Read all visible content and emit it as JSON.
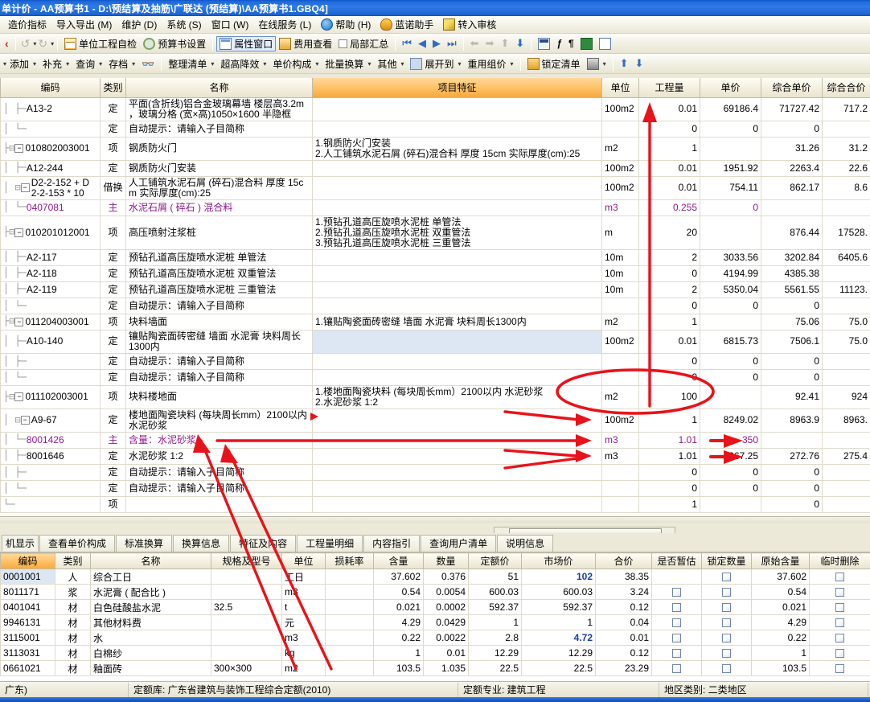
{
  "window": {
    "title": "单计价  -  AA预算书1  -  D:\\预结算及抽筋\\广联达 (预结算)\\AA预算书1.GBQ4]"
  },
  "menubar": {
    "items": [
      {
        "label": "造价指标",
        "icon": ""
      },
      {
        "label": "导入导出 (M)",
        "icon": ""
      },
      {
        "label": "维护 (D)",
        "icon": ""
      },
      {
        "label": "系统 (S)",
        "icon": ""
      },
      {
        "label": "窗口 (W)",
        "icon": ""
      },
      {
        "label": "在线服务 (L)",
        "icon": ""
      },
      {
        "label": "帮助 (H)",
        "icon": "help-icon"
      },
      {
        "label": "蓝诺助手",
        "icon": "hat-icon"
      },
      {
        "label": "转入审核",
        "icon": "pencil-icon"
      }
    ]
  },
  "toolbar1": {
    "back_icon": "back-chevron-icon",
    "undo_label": "↺",
    "redo_label": "↻",
    "items": [
      {
        "label": "单位工程自检",
        "icon": "grid-check-icon"
      },
      {
        "label": "预算书设置",
        "icon": "gear-icon"
      },
      {
        "label": "属性窗口",
        "icon": "property-window-icon",
        "boxed": true
      },
      {
        "label": "费用查看",
        "icon": "fee-icon"
      },
      {
        "label": "局部汇总",
        "icon": "checkbox-icon"
      }
    ],
    "nav": [
      "⏮",
      "◀",
      "▶",
      "⏭"
    ],
    "nav2": [
      "⬅",
      "➡",
      "⬆",
      "⬇"
    ],
    "right_icons": [
      "calculator-icon",
      "function-icon",
      "pilcrow-icon",
      "book-icon",
      "list-icon"
    ]
  },
  "toolbar2": {
    "items": [
      {
        "label": "添加",
        "caret": true
      },
      {
        "label": "补充",
        "caret": true
      },
      {
        "label": "查询",
        "caret": true
      },
      {
        "label": "存档",
        "caret": true
      },
      {
        "label": "",
        "icon": "binoculars-icon"
      },
      {
        "label": "整理清单",
        "caret": true
      },
      {
        "label": "超高降效",
        "caret": true
      },
      {
        "label": "单价构成",
        "caret": true
      },
      {
        "label": "批量换算",
        "caret": true
      },
      {
        "label": "其他",
        "caret": true
      },
      {
        "label": "展开到",
        "caret": true,
        "icon": "expand-to-icon"
      },
      {
        "label": "重用组价",
        "caret": true
      },
      {
        "label": "锁定清单",
        "icon": "lock-icon"
      },
      {
        "label": "",
        "icon": "fill-color-icon",
        "caret": true
      }
    ],
    "up_arrow": "⬆",
    "down_arrow": "⬇"
  },
  "main_grid": {
    "columns": [
      "编码",
      "类别",
      "名称",
      "项目特征",
      "单位",
      "工程量",
      "单价",
      "综合单价",
      "综合合价"
    ],
    "highlight_column": "项目特征",
    "rows": [
      {
        "tree": "│  ├─",
        "code": "A13-2",
        "cat": "定",
        "name": "平面(含折线)铝合金玻璃幕墙 楼层高3.2m\n，玻璃分格 (宽×高)1050×1600 半隐框",
        "feature": "",
        "unit": "100m2",
        "qty": "0.01",
        "price": "69186.4",
        "uprice": "71727.42",
        "total": "717.2"
      },
      {
        "tree": "│  └─",
        "code": "",
        "cat": "定",
        "name": "自动提示：请输入子目简称",
        "ghost": true,
        "feature": "",
        "unit": "",
        "qty": "0",
        "price": "0",
        "uprice": "0",
        "total": ""
      },
      {
        "tree": "├⊟",
        "expander": "−",
        "code": "010802003001",
        "cat": "项",
        "name": "钢质防火门",
        "feature": "1.钢质防火门安装\n2.人工铺筑水泥石屑 (碎石)混合料  厚度 15cm  实际厚度(cm):25",
        "unit": "m2",
        "qty": "1",
        "price": "",
        "uprice": "31.26",
        "total": "31.2"
      },
      {
        "tree": "│  ├─",
        "code": "A12-244",
        "cat": "定",
        "name": "钢质防火门安装",
        "feature": "",
        "unit": "100m2",
        "qty": "0.01",
        "price": "1951.92",
        "uprice": "2263.4",
        "total": "22.6"
      },
      {
        "tree": "│  ⊟",
        "expander": "−",
        "code": "D2-2-152 + D\n2-2-153 * 10",
        "cat": "借换",
        "name": "人工铺筑水泥石屑 (碎石)混合料  厚度 15c\nm  实际厚度(cm):25",
        "feature": "",
        "unit": "100m2",
        "qty": "0.01",
        "price": "754.11",
        "uprice": "862.17",
        "total": "8.6"
      },
      {
        "tree": "│    └─",
        "code": "0407081",
        "cat": "主",
        "name": "水泥石屑 ( 碎石 ) 混合料",
        "zhu": true,
        "feature": "",
        "unit": "m3",
        "qty": "0.255",
        "price": "0",
        "uprice": "",
        "total": ""
      },
      {
        "tree": "├⊟",
        "expander": "−",
        "code": "010201012001",
        "cat": "项",
        "name": "高压喷射注浆桩",
        "feature": "1.预钻孔道高压旋喷水泥桩  单管法\n2.预钻孔道高压旋喷水泥桩  双重管法\n3.预钻孔道高压旋喷水泥桩  三重管法",
        "unit": "m",
        "qty": "20",
        "price": "",
        "uprice": "876.44",
        "total": "17528."
      },
      {
        "tree": "│  ├─",
        "code": "A2-117",
        "cat": "定",
        "name": "预钻孔道高压旋喷水泥桩  单管法",
        "feature": "",
        "unit": "10m",
        "qty": "2",
        "price": "3033.56",
        "uprice": "3202.84",
        "total": "6405.6"
      },
      {
        "tree": "│  ├─",
        "code": "A2-118",
        "cat": "定",
        "name": "预钻孔道高压旋喷水泥桩  双重管法",
        "feature": "",
        "unit": "10m",
        "qty": "0",
        "price": "4194.99",
        "uprice": "4385.38",
        "total": ""
      },
      {
        "tree": "│  ├─",
        "code": "A2-119",
        "cat": "定",
        "name": "预钻孔道高压旋喷水泥桩  三重管法",
        "feature": "",
        "unit": "10m",
        "qty": "2",
        "price": "5350.04",
        "uprice": "5561.55",
        "total": "11123."
      },
      {
        "tree": "│  └─",
        "code": "",
        "cat": "定",
        "name": "自动提示：请输入子目简称",
        "ghost": true,
        "feature": "",
        "unit": "",
        "qty": "0",
        "price": "0",
        "uprice": "0",
        "total": ""
      },
      {
        "tree": "├⊟",
        "expander": "−",
        "code": "011204003001",
        "cat": "项",
        "name": "块料墙面",
        "feature": "1.镶贴陶瓷面砖密缝 墙面 水泥膏 块料周长1300内",
        "unit": "m2",
        "qty": "1",
        "price": "",
        "uprice": "75.06",
        "total": "75.0"
      },
      {
        "tree": "│  ├─",
        "code": "A10-140",
        "cat": "定",
        "name": "镶贴陶瓷面砖密缝  墙面  水泥膏  块料周长\n1300内",
        "feature": "",
        "unit": "100m2",
        "qty": "0.01",
        "price": "6815.73",
        "uprice": "7506.1",
        "total": "75.0",
        "selected": true
      },
      {
        "tree": "│  ├─",
        "code": "",
        "cat": "定",
        "name": "自动提示：请输入子目简称",
        "ghost": true,
        "feature": "",
        "unit": "",
        "qty": "0",
        "price": "0",
        "uprice": "0",
        "total": ""
      },
      {
        "tree": "│  └─",
        "code": "",
        "cat": "定",
        "name": "自动提示：请输入子目简称",
        "ghost": true,
        "feature": "",
        "unit": "",
        "qty": "0",
        "price": "0",
        "uprice": "0",
        "total": ""
      },
      {
        "tree": "├⊟",
        "expander": "−",
        "code": "011102003001",
        "cat": "项",
        "name": "块料楼地面",
        "feature": "1.楼地面陶瓷块料 (每块周长mm）2100以内  水泥砂浆\n2.水泥砂浆 1:2",
        "unit": "m2",
        "qty": "100",
        "price": "",
        "uprice": "92.41",
        "total": "924"
      },
      {
        "tree": "│  ⊟",
        "expander": "−",
        "code": "A9-67",
        "cat": "定",
        "name": "楼地面陶瓷块料 (每块周长mm）2100以内\n水泥砂浆",
        "feature": "",
        "unit": "100m2",
        "qty": "1",
        "price": "8249.02",
        "uprice": "8963.9",
        "total": "8963."
      },
      {
        "tree": "│    └─",
        "code": "8001426",
        "cat": "主",
        "name": "含量：水泥砂浆",
        "zhu": true,
        "feature": "",
        "unit": "m3",
        "qty": "1.01",
        "price": "350",
        "uprice": "",
        "total": ""
      },
      {
        "tree": "│  ├─",
        "code": "8001646",
        "cat": "定",
        "name": "水泥砂浆 1:2",
        "feature": "",
        "unit": "m3",
        "qty": "1.01",
        "price": "267.25",
        "uprice": "272.76",
        "total": "275.4"
      },
      {
        "tree": "│  ├─",
        "code": "",
        "cat": "定",
        "name": "自动提示：请输入子目简称",
        "ghost": true,
        "feature": "",
        "unit": "",
        "qty": "0",
        "price": "0",
        "uprice": "0",
        "total": ""
      },
      {
        "tree": "│  └─",
        "code": "",
        "cat": "定",
        "name": "自动提示：请输入子目简称",
        "ghost": true,
        "feature": "",
        "unit": "",
        "qty": "0",
        "price": "0",
        "uprice": "0",
        "total": ""
      },
      {
        "tree": "└─",
        "code": "",
        "cat": "项",
        "name": "",
        "feature": "",
        "unit": "",
        "qty": "1",
        "price": "",
        "uprice": "0",
        "total": ""
      }
    ]
  },
  "bottom_tabs": {
    "items": [
      {
        "label": "机显示",
        "active": true,
        "partial": true
      },
      {
        "label": "查看单价构成"
      },
      {
        "label": "标准换算"
      },
      {
        "label": "换算信息"
      },
      {
        "label": "特征及内容"
      },
      {
        "label": "工程量明细"
      },
      {
        "label": "内容指引"
      },
      {
        "label": "查询用户清单"
      },
      {
        "label": "说明信息"
      }
    ]
  },
  "bottom_grid": {
    "columns": [
      "编码",
      "类别",
      "名称",
      "规格及型号",
      "单位",
      "损耗率",
      "含量",
      "数量",
      "定额价",
      "市场价",
      "合价",
      "是否暂估",
      "锁定数量",
      "原始含量",
      "临时删除"
    ],
    "highlight_column": "编码",
    "rows": [
      {
        "code": "0001001",
        "cat": "人",
        "name": "综合工日",
        "spec": "",
        "unit": "工日",
        "loss": "",
        "content": "37.602",
        "qty": "0.376",
        "dprice": "51",
        "mprice": "102",
        "mprice_bold": true,
        "total": "38.35",
        "estimate": false,
        "estimate_show": false,
        "lock": true,
        "orig": "37.602",
        "del": true,
        "selected": true
      },
      {
        "code": "8011171",
        "cat": "浆",
        "name": "水泥膏 ( 配合比 )",
        "spec": "",
        "unit": "m3",
        "loss": "",
        "content": "0.54",
        "qty": "0.0054",
        "dprice": "600.03",
        "mprice": "600.03",
        "total": "3.24",
        "estimate": true,
        "estimate_show": true,
        "lock": true,
        "orig": "0.54",
        "del": true
      },
      {
        "code": "0401041",
        "cat": "材",
        "name": "白色硅酸盐水泥",
        "spec": "32.5",
        "unit": "t",
        "loss": "",
        "content": "0.021",
        "qty": "0.0002",
        "dprice": "592.37",
        "mprice": "592.37",
        "total": "0.12",
        "estimate": true,
        "estimate_show": true,
        "lock": true,
        "orig": "0.021",
        "del": true
      },
      {
        "code": "9946131",
        "cat": "材",
        "name": "其他材料费",
        "spec": "",
        "unit": "元",
        "loss": "",
        "content": "4.29",
        "qty": "0.0429",
        "dprice": "1",
        "mprice": "1",
        "total": "0.04",
        "estimate": true,
        "estimate_show": true,
        "lock": true,
        "orig": "4.29",
        "del": true
      },
      {
        "code": "3115001",
        "cat": "材",
        "name": "水",
        "spec": "",
        "unit": "m3",
        "loss": "",
        "content": "0.22",
        "qty": "0.0022",
        "dprice": "2.8",
        "mprice": "4.72",
        "mprice_bold": true,
        "total": "0.01",
        "estimate": true,
        "estimate_show": true,
        "lock": true,
        "orig": "0.22",
        "del": true
      },
      {
        "code": "3113031",
        "cat": "材",
        "name": "白棉纱",
        "spec": "",
        "unit": "kg",
        "loss": "",
        "content": "1",
        "qty": "0.01",
        "dprice": "12.29",
        "mprice": "12.29",
        "total": "0.12",
        "estimate": true,
        "estimate_show": true,
        "lock": true,
        "orig": "1",
        "del": true
      },
      {
        "code": "0661021",
        "cat": "材",
        "name": "釉面砖",
        "spec": "300×300",
        "unit": "m2",
        "loss": "",
        "content": "103.5",
        "qty": "1.035",
        "dprice": "22.5",
        "mprice": "22.5",
        "total": "23.29",
        "estimate": true,
        "estimate_show": true,
        "lock": true,
        "orig": "103.5",
        "del": true
      }
    ]
  },
  "statusbar": {
    "cells": [
      {
        "label": "广东)"
      },
      {
        "label": "定额库: 广东省建筑与装饰工程综合定额(2010)"
      },
      {
        "label": "定额专业: 建筑工程"
      },
      {
        "label": "地区类别: 二类地区"
      }
    ]
  },
  "annotations": {
    "color": "#e8131a",
    "note": "red hand-drawn arrows and ellipse overlay"
  }
}
